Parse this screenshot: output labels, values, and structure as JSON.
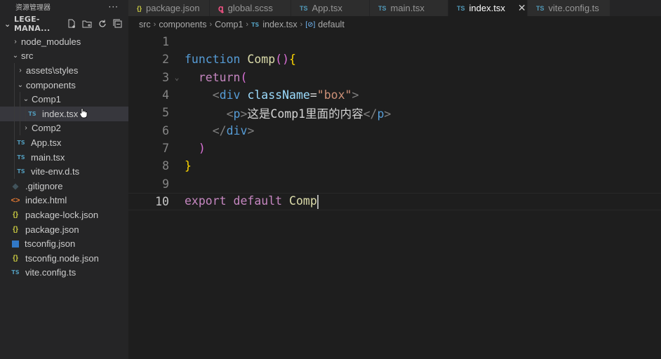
{
  "sidebar": {
    "title": "资源管理器",
    "more": "···",
    "project": "LEGE-MANA...",
    "items": [
      {
        "label": "node_modules",
        "type": "folder",
        "open": false,
        "depth": 0
      },
      {
        "label": "src",
        "type": "folder",
        "open": true,
        "depth": 0
      },
      {
        "label": "assets\\styles",
        "type": "folder",
        "open": false,
        "depth": 1
      },
      {
        "label": "components",
        "type": "folder",
        "open": true,
        "depth": 1
      },
      {
        "label": "Comp1",
        "type": "folder",
        "open": true,
        "depth": 2
      },
      {
        "label": "index.tsx",
        "type": "ts",
        "depth": 3,
        "selected": true
      },
      {
        "label": "Comp2",
        "type": "folder",
        "open": false,
        "depth": 2
      },
      {
        "label": "App.tsx",
        "type": "ts",
        "depth": 1
      },
      {
        "label": "main.tsx",
        "type": "ts",
        "depth": 1
      },
      {
        "label": "vite-env.d.ts",
        "type": "ts",
        "depth": 1
      },
      {
        "label": ".gitignore",
        "type": "git",
        "depth": 0
      },
      {
        "label": "index.html",
        "type": "html",
        "depth": 0
      },
      {
        "label": "package-lock.json",
        "type": "json",
        "depth": 0
      },
      {
        "label": "package.json",
        "type": "json",
        "depth": 0
      },
      {
        "label": "tsconfig.json",
        "type": "tsconfig",
        "depth": 0
      },
      {
        "label": "tsconfig.node.json",
        "type": "json",
        "depth": 0
      },
      {
        "label": "vite.config.ts",
        "type": "ts",
        "depth": 0
      }
    ]
  },
  "tabs": [
    {
      "label": "package.json",
      "icon": "{}",
      "icon_color": "#cbcb41"
    },
    {
      "label": "global.scss",
      "icon": "ꝗ",
      "icon_color": "#f55385"
    },
    {
      "label": "App.tsx",
      "icon": "TS",
      "icon_color": "#519aba"
    },
    {
      "label": "main.tsx",
      "icon": "TS",
      "icon_color": "#519aba"
    },
    {
      "label": "index.tsx",
      "icon": "TS",
      "icon_color": "#519aba",
      "active": true
    },
    {
      "label": "vite.config.ts",
      "icon": "TS",
      "icon_color": "#519aba"
    }
  ],
  "close_glyph": "✕",
  "breadcrumb": {
    "parts": [
      "src",
      "components",
      "Comp1"
    ],
    "file": "index.tsx",
    "file_icon": "TS",
    "symbol": "default",
    "symbol_icon": "[⊘]"
  },
  "editor": {
    "line_numbers": [
      "1",
      "2",
      "3",
      "4",
      "5",
      "6",
      "7",
      "8",
      "9",
      "10"
    ],
    "current_line": 10,
    "code": {
      "l2_kw": "function",
      "l2_name": "Comp",
      "l2_paren": "()",
      "l2_brace": "{",
      "l3_kw": "return",
      "l3_paren": "(",
      "l4_open": "<",
      "l4_tag": "div",
      "l4_attr": "className",
      "l4_eq": "=",
      "l4_val": "\"box\"",
      "l4_close": ">",
      "l5_open": "<",
      "l5_tag": "p",
      "l5_close": ">",
      "l5_text": "这是Comp1里面的内容",
      "l5_endopen": "</",
      "l5_endtag": "p",
      "l5_endclose": ">",
      "l6_open": "</",
      "l6_tag": "div",
      "l6_close": ">",
      "l7_paren": ")",
      "l8_brace": "}",
      "l10_kw1": "export",
      "l10_kw2": "default",
      "l10_name": "Comp"
    }
  },
  "colors": {
    "sidebar_bg": "#252526",
    "editor_bg": "#1e1e1e",
    "selected_row": "#37373d",
    "ts_icon": "#519aba",
    "json_icon": "#cbcb41"
  }
}
